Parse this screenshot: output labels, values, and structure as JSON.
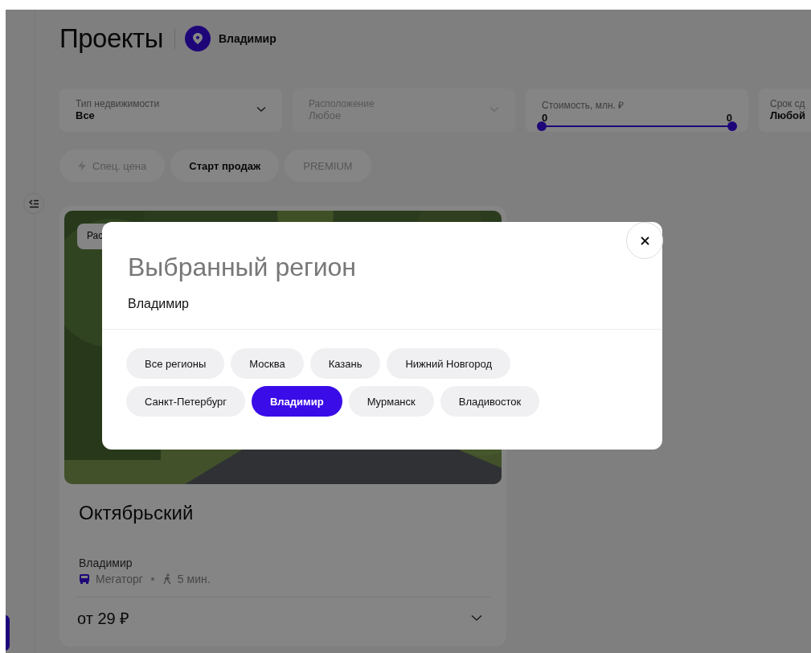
{
  "header": {
    "title": "Проекты",
    "city": "Владимир"
  },
  "filters": [
    {
      "label": "Тип недвижимости",
      "value": "Все",
      "kind": "select",
      "disabled": false
    },
    {
      "label": "Расположение",
      "value": "Любое",
      "kind": "select",
      "disabled": true
    },
    {
      "label": "Стоимость, млн. ₽",
      "min": "0",
      "max": "0",
      "kind": "range",
      "level": 1
    },
    {
      "label": "Срок сд",
      "value": "Любой",
      "kind": "select",
      "disabled": false
    }
  ],
  "quick_filters": [
    {
      "label": "Спец. цена",
      "kind": "special",
      "disabled": true
    },
    {
      "label": "Старт продаж",
      "kind": "plain",
      "disabled": false
    },
    {
      "label": "PREMIUM",
      "kind": "plain",
      "disabled": true
    }
  ],
  "project_card": {
    "badge": "Рас",
    "name": "Октябрьский",
    "city": "Владимир",
    "transport": "Мегаторг",
    "walk": "5 мин.",
    "price": "от 29 ₽"
  },
  "modal": {
    "title": "Выбранный регион",
    "current": "Владимир",
    "regions": [
      {
        "label": "Все регионы",
        "selected": false
      },
      {
        "label": "Москва",
        "selected": false
      },
      {
        "label": "Казань",
        "selected": false
      },
      {
        "label": "Нижний Новгород",
        "selected": false
      },
      {
        "label": "Санкт-Петербург",
        "selected": false
      },
      {
        "label": "Владимир",
        "selected": true
      },
      {
        "label": "Мурманск",
        "selected": false
      },
      {
        "label": "Владивосток",
        "selected": false
      }
    ]
  }
}
